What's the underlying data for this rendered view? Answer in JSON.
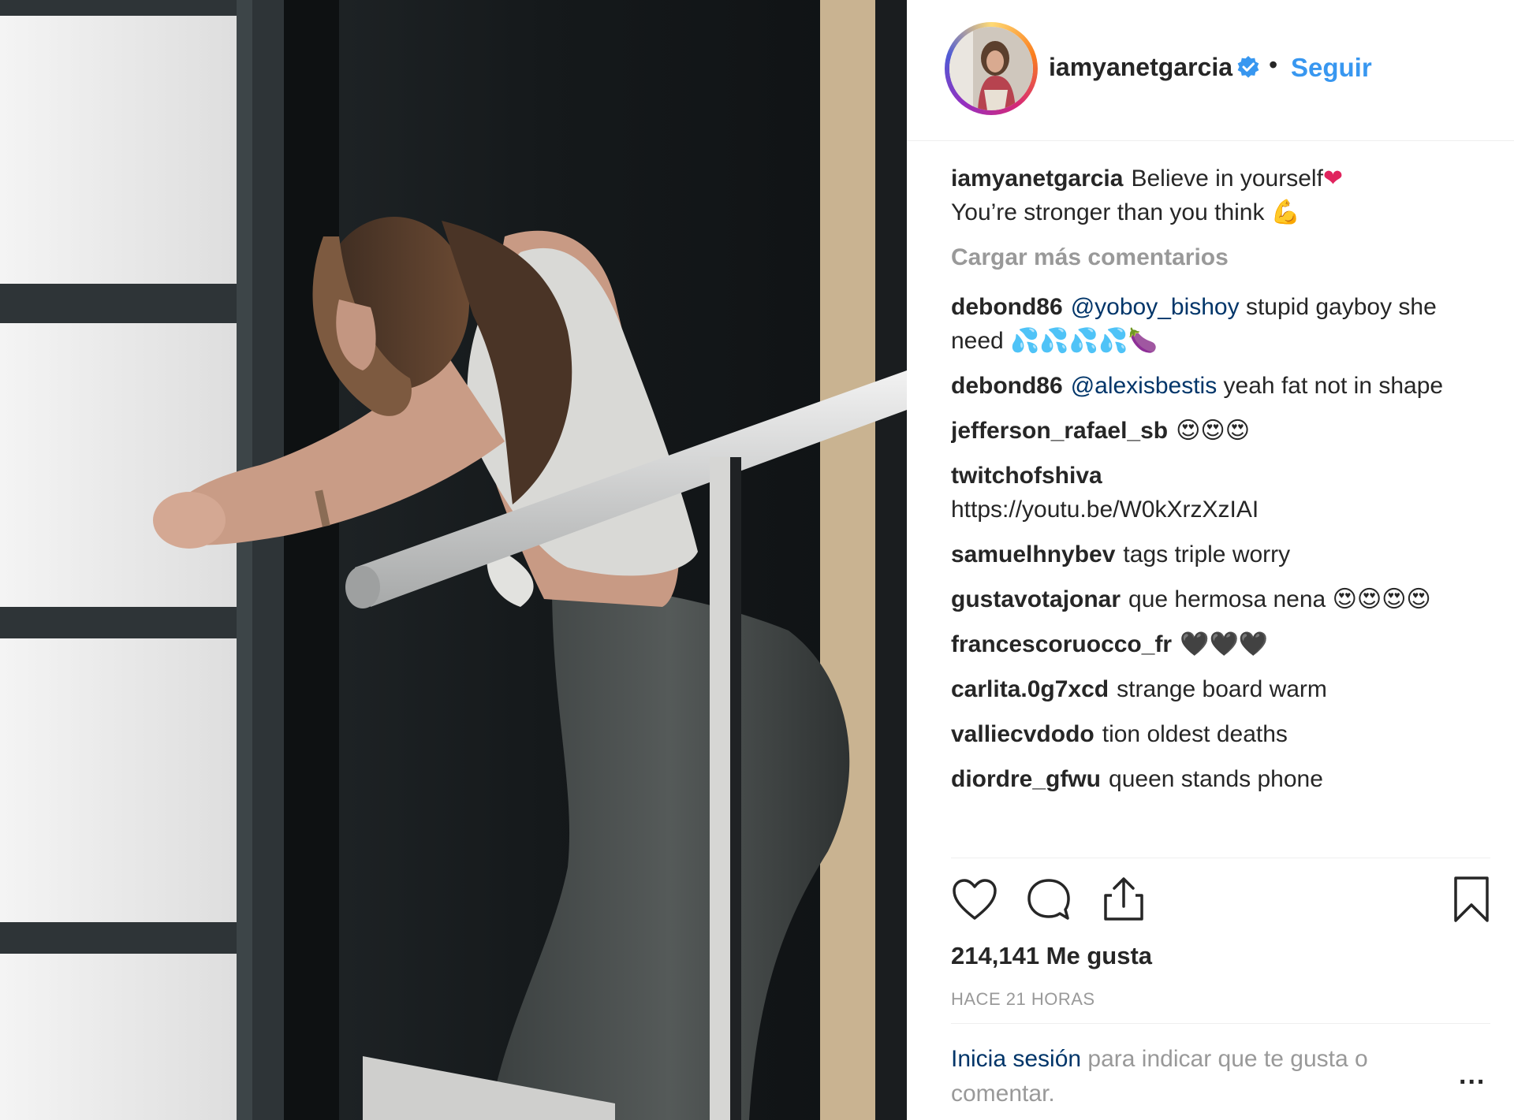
{
  "post": {
    "username": "iamyanetgarcia",
    "follow_label": "Seguir",
    "separator": "•",
    "caption": {
      "user": "iamyanetgarcia",
      "line1": "Believe in yourself",
      "line1_emoji": "❤",
      "line2": "You’re stronger than you think",
      "line2_emoji": "💪"
    },
    "load_more": "Cargar más comentarios",
    "comments": [
      {
        "user": "debond86",
        "mention": "@yoboy_bishoy",
        "text": " stupid gayboy she need ",
        "emoji": "💦💦💦💦🍆"
      },
      {
        "user": "debond86",
        "mention": "@alexisbestis",
        "text": " yeah fat not in shape",
        "emoji": ""
      },
      {
        "user": "jefferson_rafael_sb",
        "mention": "",
        "text": "",
        "emoji": "😍😍😍"
      },
      {
        "user": "twitchofshiva",
        "mention": "",
        "text": "https://youtu.be/W0kXrzXzIAI",
        "emoji": ""
      },
      {
        "user": "samuelhnybev",
        "mention": "",
        "text": "tags triple worry",
        "emoji": ""
      },
      {
        "user": "gustavotajonar",
        "mention": "",
        "text": "que hermosa nena ",
        "emoji": "😍😍😍😍"
      },
      {
        "user": "francescoruocco_fr",
        "mention": "",
        "text": "",
        "emoji": "🖤🖤🖤"
      },
      {
        "user": "carlita.0g7xcd",
        "mention": "",
        "text": "strange board warm",
        "emoji": ""
      },
      {
        "user": "valliecvdodo",
        "mention": "",
        "text": "tion oldest deaths",
        "emoji": ""
      },
      {
        "user": "diordre_gfwu",
        "mention": "",
        "text": "queen stands phone",
        "emoji": ""
      }
    ],
    "likes": "214,141 Me gusta",
    "timestamp": "HACE 21 HORAS",
    "footer": {
      "login_link": "Inicia sesión",
      "rest": " para indicar que te gusta o comentar."
    },
    "more_label": "..."
  },
  "icons": [
    "heart-icon",
    "comment-icon",
    "share-icon",
    "bookmark-icon",
    "verified-badge-icon"
  ],
  "colors": {
    "link": "#3897f0",
    "mention": "#003569",
    "muted": "#999999",
    "text": "#262626"
  }
}
